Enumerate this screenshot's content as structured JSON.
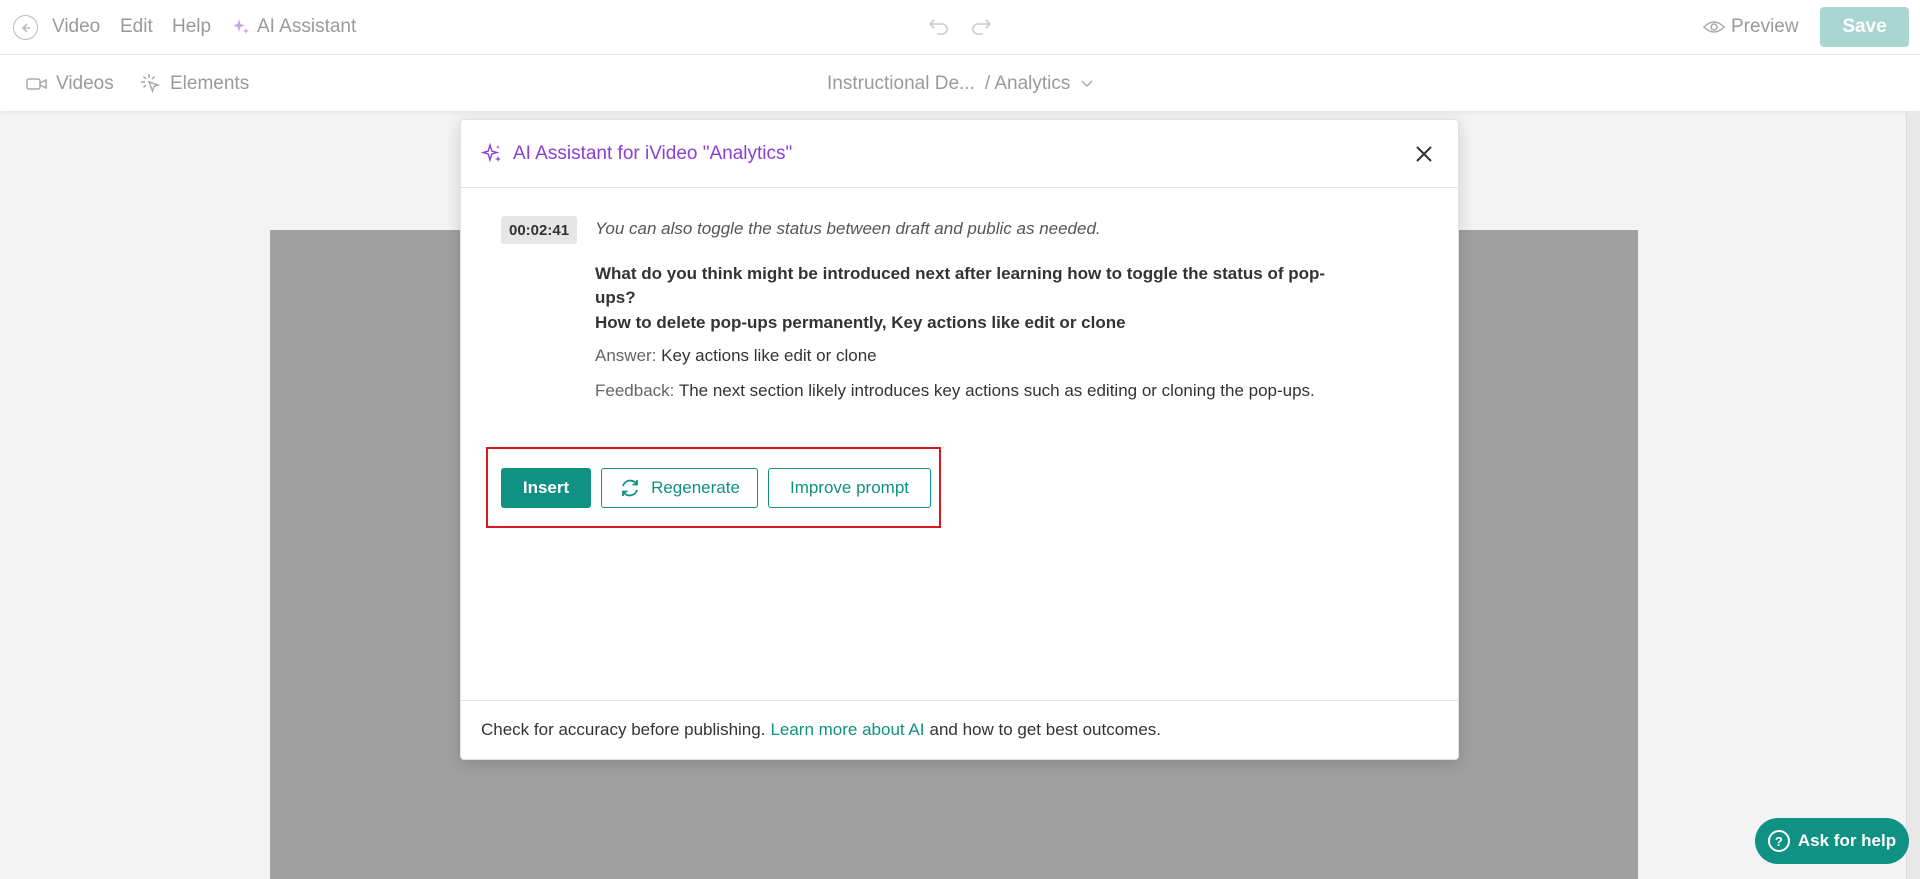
{
  "menu": {
    "video": "Video",
    "edit": "Edit",
    "help": "Help",
    "ai_assistant": "AI Assistant",
    "preview": "Preview",
    "save": "Save"
  },
  "subnav": {
    "videos": "Videos",
    "elements": "Elements",
    "breadcrumb_project": "Instructional De...",
    "breadcrumb_video": "/ Analytics"
  },
  "modal": {
    "title": "AI Assistant for iVideo \"Analytics\"",
    "timestamp": "00:02:41",
    "transcript": "You can also toggle the status between draft and public as needed.",
    "question": "What do you think might be introduced next after learning how to toggle the status of pop-ups?",
    "options": "How to delete pop-ups permanently, Key actions like edit or clone",
    "answer_label": "Answer:",
    "answer_value": "Key actions like edit or clone",
    "feedback_label": "Feedback:",
    "feedback_value": "The next section likely introduces key actions such as editing or cloning the pop-ups.",
    "insert_label": "Insert",
    "regenerate_label": "Regenerate",
    "improve_label": "Improve prompt",
    "footer_before": "Check for accuracy before publishing.",
    "footer_link": "Learn more about AI",
    "footer_after": "and how to get best outcomes."
  },
  "help_button": "Ask for help",
  "colors": {
    "accent": "#0f9183",
    "ai_purple": "#8a3ed6",
    "highlight": "#d9191f"
  }
}
